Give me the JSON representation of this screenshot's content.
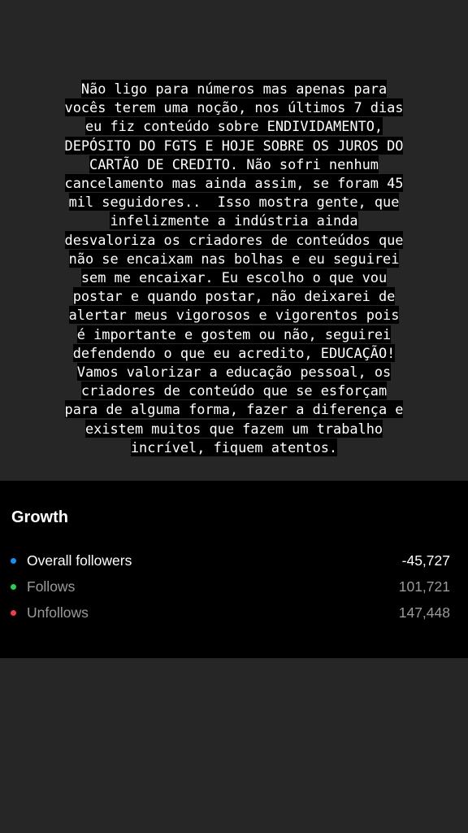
{
  "story": {
    "lines": [
      "Não ligo para números mas apenas para",
      "vocês terem uma noção, nos últimos 7 dias",
      "eu fiz conteúdo sobre ENDIVIDAMENTO,",
      "DEPÓSITO DO FGTS E HOJE SOBRE OS JUROS DO",
      "CARTÃO DE CREDITO. Não sofri nenhum",
      "cancelamento mas ainda assim, se foram 45",
      "mil seguidores..  Isso mostra gente, que",
      "infelizmente a indústria ainda",
      "desvaloriza os criadores de conteúdos que",
      "não se encaixam nas bolhas e eu seguirei",
      "sem me encaixar. Eu escolho o que vou",
      "postar e quando postar, não deixarei de",
      "alertar meus vigorosos e vigorentos pois",
      "é importante e gostem ou não, seguirei",
      "defendendo o que eu acredito, EDUCAÇÃO!",
      "Vamos valorizar a educação pessoal, os",
      "criadores de conteúdo que se esforçam",
      "para de alguma forma, fazer a diferença e",
      "existem muitos que fazem um trabalho",
      "incrível, fiquem atentos."
    ]
  },
  "growth": {
    "title": "Growth",
    "metrics": [
      {
        "label": "Overall followers",
        "value": "-45,727",
        "dot_color": "#1e8cf0",
        "label_color": "#ffffff",
        "value_color": "#ffffff"
      },
      {
        "label": "Follows",
        "value": "101,721",
        "dot_color": "#2ecc55",
        "label_color": "#9a9a9a",
        "value_color": "#9a9a9a"
      },
      {
        "label": "Unfollows",
        "value": "147,448",
        "dot_color": "#ef3b4f",
        "label_color": "#9a9a9a",
        "value_color": "#9a9a9a"
      }
    ]
  }
}
